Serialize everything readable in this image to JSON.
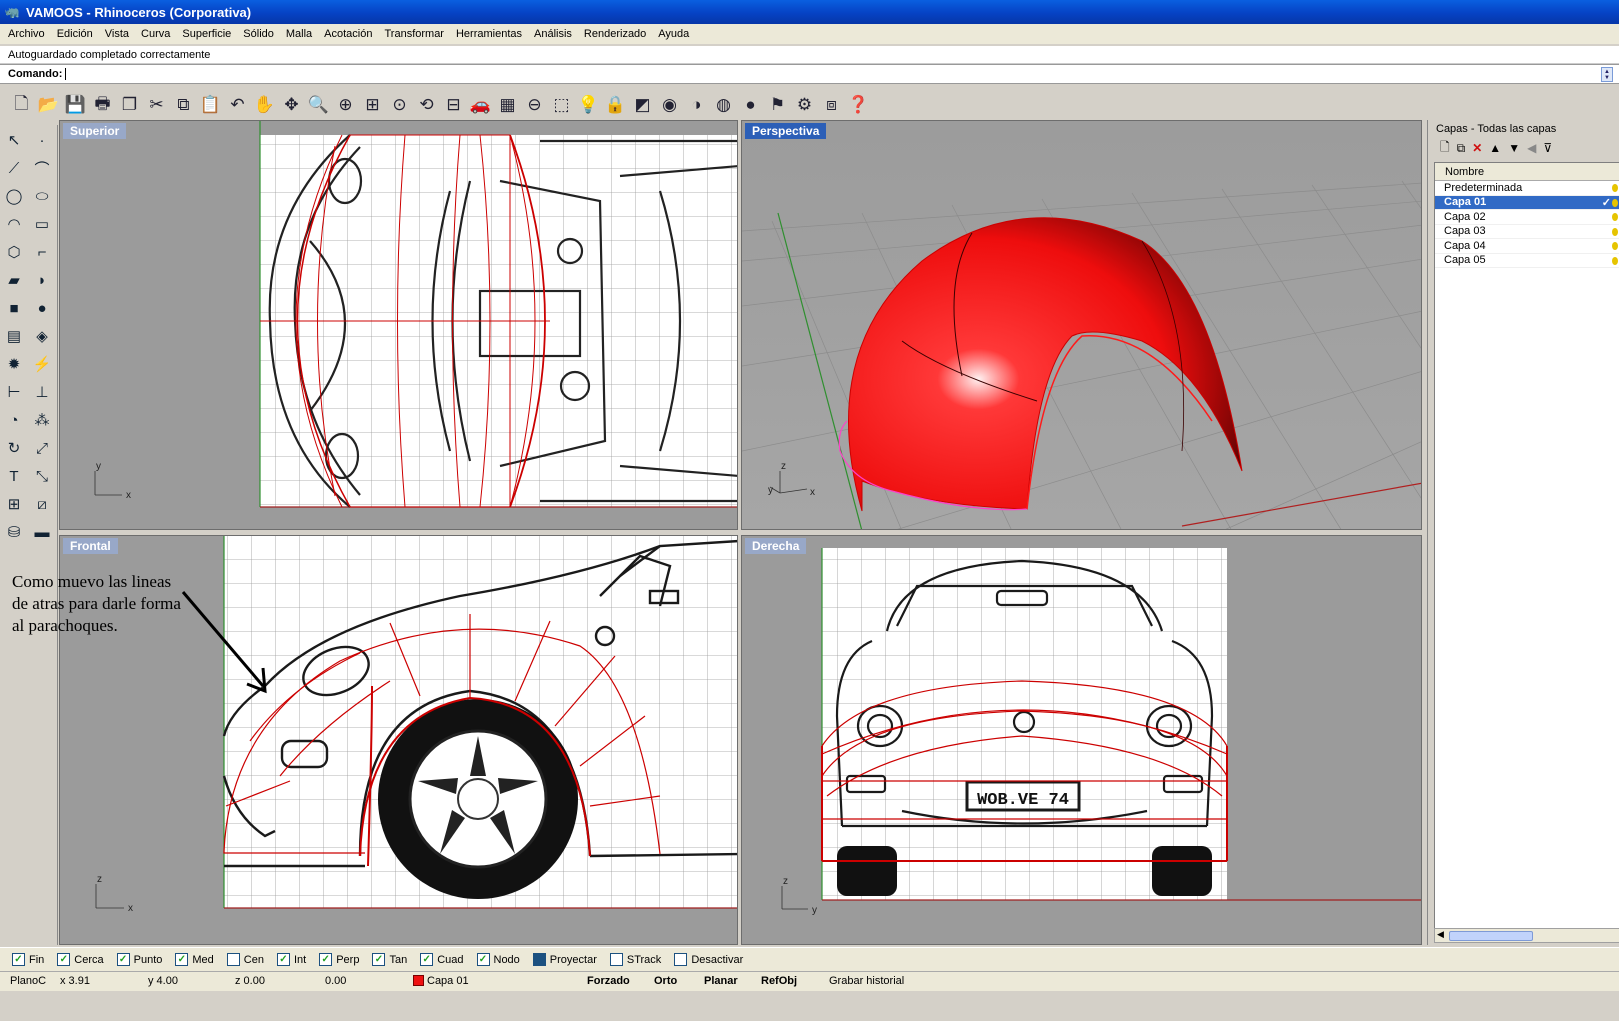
{
  "window": {
    "title": "VAMOOS - Rhinoceros (Corporativa)"
  },
  "menu": [
    "Archivo",
    "Edición",
    "Vista",
    "Curva",
    "Superficie",
    "Sólido",
    "Malla",
    "Acotación",
    "Transformar",
    "Herramientas",
    "Análisis",
    "Renderizado",
    "Ayuda"
  ],
  "history": {
    "text": "Autoguardado completado correctamente"
  },
  "command": {
    "label": "Comando:"
  },
  "viewports": {
    "top": "Superior",
    "perspective": "Perspectiva",
    "front": "Frontal",
    "right": "Derecha"
  },
  "axes": {
    "top": [
      "y",
      "x"
    ],
    "perspective": [
      "z",
      "y",
      "x"
    ],
    "front": [
      "z",
      "x"
    ],
    "right": [
      "z",
      "y"
    ]
  },
  "annotation": {
    "text": "Como muevo las lineas de atras para darle forma al parachoques."
  },
  "plate": {
    "text": "WOB.VE 74"
  },
  "layers": {
    "title": "Capas - Todas las capas",
    "column": "Nombre",
    "items": [
      "Predeterminada",
      "Capa 01",
      "Capa 02",
      "Capa 03",
      "Capa 04",
      "Capa 05"
    ],
    "selected": "Capa 01"
  },
  "osnap": [
    {
      "label": "Fin",
      "checked": true
    },
    {
      "label": "Cerca",
      "checked": true
    },
    {
      "label": "Punto",
      "checked": true
    },
    {
      "label": "Med",
      "checked": true
    },
    {
      "label": "Cen",
      "checked": false
    },
    {
      "label": "Int",
      "checked": true
    },
    {
      "label": "Perp",
      "checked": true
    },
    {
      "label": "Tan",
      "checked": true
    },
    {
      "label": "Cuad",
      "checked": true
    },
    {
      "label": "Nodo",
      "checked": true
    },
    {
      "label": "Proyectar",
      "checked": true
    },
    {
      "label": "STrack",
      "checked": false
    },
    {
      "label": "Desactivar",
      "checked": false
    }
  ],
  "status": {
    "cplane": "PlanoC",
    "x": "x 3.91",
    "y": "y 4.00",
    "z": "z 0.00",
    "dist": "0.00",
    "layer": "Capa 01",
    "snap": "Forzado",
    "ortho": "Orto",
    "planar": "Planar",
    "osnap": "RefObj",
    "history": "Grabar historial"
  },
  "colors": {
    "title": "#0a5fe0",
    "selection": "#316ac5",
    "curve": "#cc0000",
    "surface": "#ee1111"
  }
}
